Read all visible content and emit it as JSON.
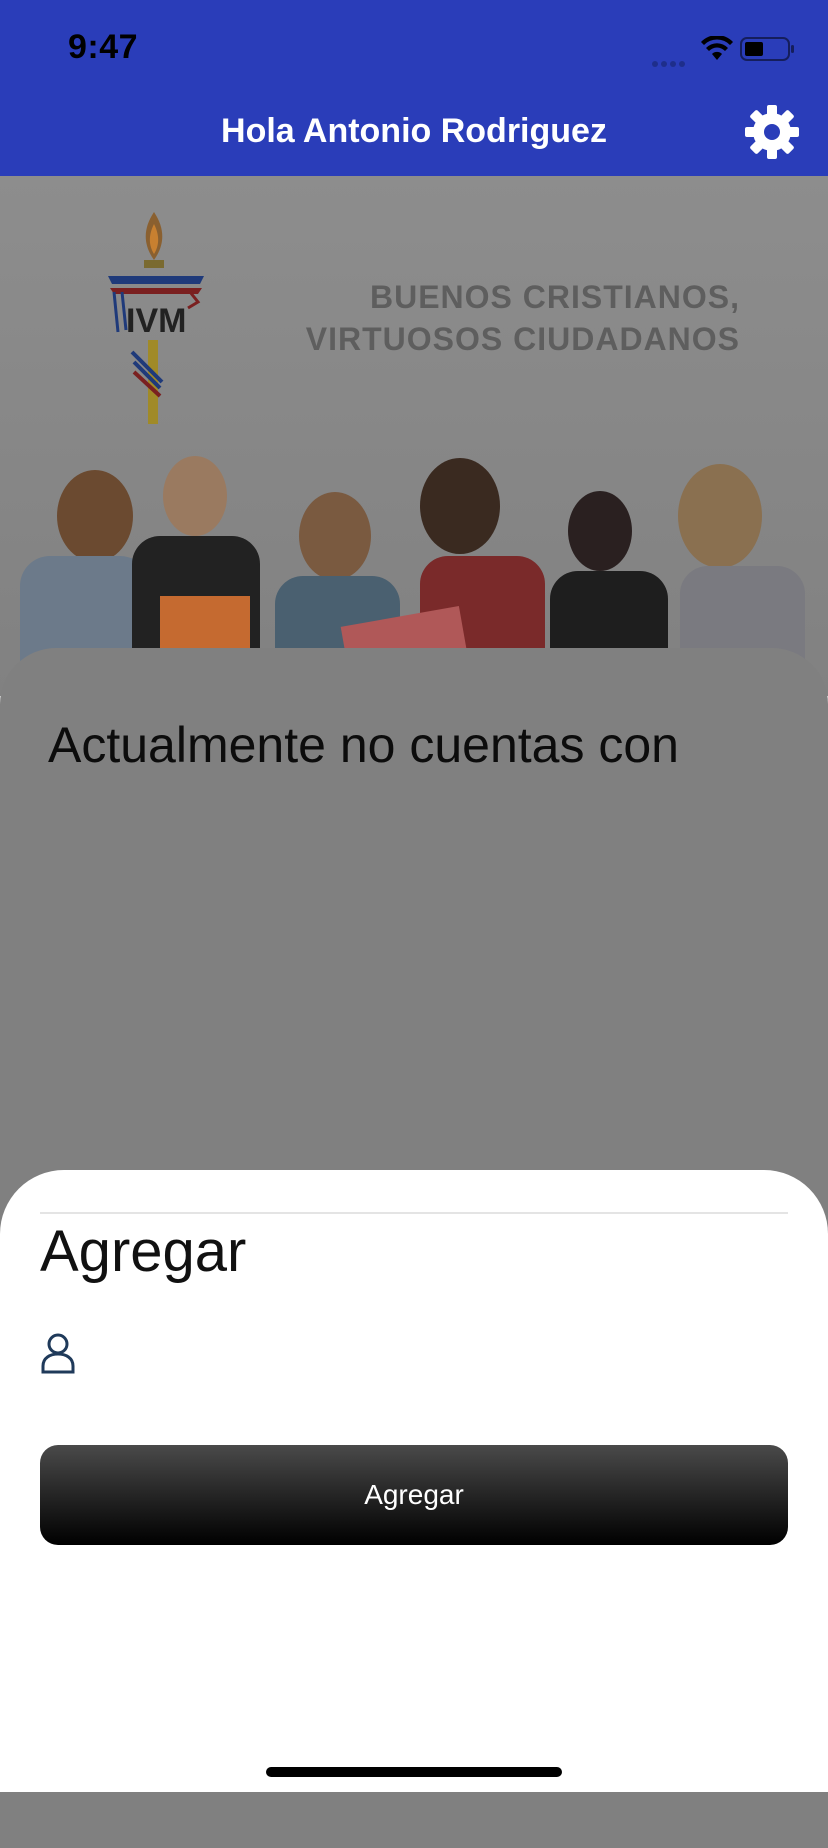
{
  "status_bar": {
    "time": "9:47"
  },
  "header": {
    "title": "Hola Antonio Rodriguez"
  },
  "hero": {
    "tagline_line1": "BUENOS CRISTIANOS,",
    "tagline_line2": "VIRTUOSOS CIUDADANOS",
    "logo_text": "IVM"
  },
  "main": {
    "empty_message": "Actualmente no cuentas con"
  },
  "sheet": {
    "title": "Agregar",
    "input_value": "",
    "button_label": "Agregar"
  },
  "colors": {
    "brand": "#2a3db9",
    "overlay": "#808080",
    "button": "#000000"
  },
  "icons": {
    "settings": "gear-icon",
    "user": "user-icon",
    "wifi": "wifi-icon",
    "battery": "battery-icon"
  }
}
